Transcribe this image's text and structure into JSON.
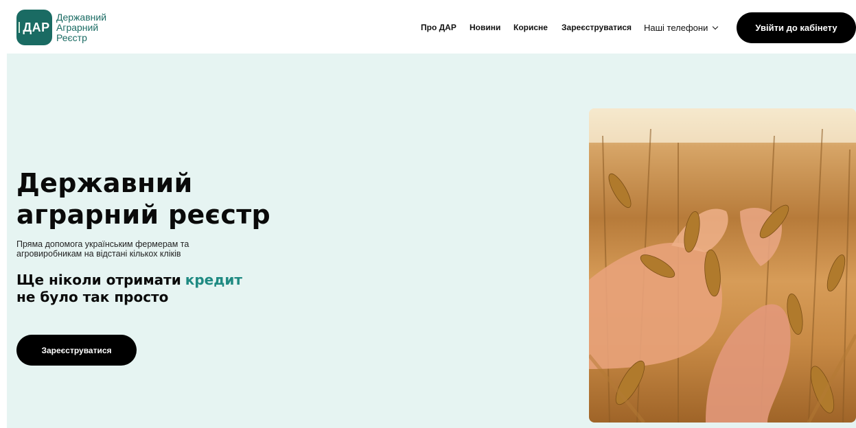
{
  "logo": {
    "badge_text": "ДАР",
    "line1": "Державний",
    "line2": "Аграрний",
    "line3": "Реєстр"
  },
  "nav": {
    "about": "Про ДАР",
    "news": "Новини",
    "useful": "Корисне",
    "register": "Зареєструватися",
    "phones": "Наші телефони"
  },
  "login_button": "Увійти до кабінету",
  "hero": {
    "title_line1": "Державний",
    "title_line2": "аграрний реєстр",
    "subtitle_line1": "Пряма допомога українським фермерам та",
    "subtitle_line2": "агровиробникам на відстані кількох кліків",
    "claim_line1": "Ще ніколи отримати",
    "claim_accent": "кредит",
    "claim_line2": "не було так просто",
    "register_button": "Зареєструватися"
  },
  "colors": {
    "brand": "#1a6b63",
    "accent": "#1f8a82",
    "hero_bg": "#e6f4f2",
    "button_bg": "#000000"
  },
  "icons": {
    "phones_dropdown": "chevron-down-icon",
    "logo_mark": "wheat-icon"
  }
}
